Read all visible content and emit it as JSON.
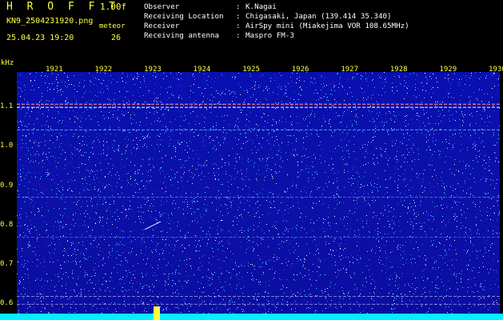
{
  "header": {
    "brand": "H R O F F T",
    "version": "1.00f",
    "filename": "KN9_2504231920.png",
    "meteor_label": "meteor",
    "datetime": "25.04.23 19:20",
    "count": "26"
  },
  "meta": [
    {
      "key": "Observer",
      "sep": ":",
      "value": "K.Nagai"
    },
    {
      "key": "Receiving Location",
      "sep": ":",
      "value": "Chigasaki, Japan (139.414 35.340)"
    },
    {
      "key": "Receiver",
      "sep": ":",
      "value": "AirSpy mini (Miakejima VOR 108.65MHz)"
    },
    {
      "key": "Receiving antenna",
      "sep": ":",
      "value": "Maspro FM-3"
    }
  ],
  "chart_data": {
    "type": "heatmap",
    "ylabel": "kHz",
    "y_ticks": [
      "1.1",
      "1.0",
      "0.9",
      "0.8",
      "0.7",
      "0.6"
    ],
    "x_ticks": [
      "1921",
      "1922",
      "1923",
      "1924",
      "1925",
      "1926",
      "1927",
      "1928",
      "1929",
      "1930"
    ],
    "ylim": [
      0.57,
      1.19
    ],
    "xlim": [
      19.2,
      19.3
    ],
    "colors": {
      "background": "#0b0ea6",
      "noise": "#3ad0ff",
      "signal": "#ffffff",
      "accent": "#ff5050",
      "baseline": "#00f0ff"
    }
  }
}
